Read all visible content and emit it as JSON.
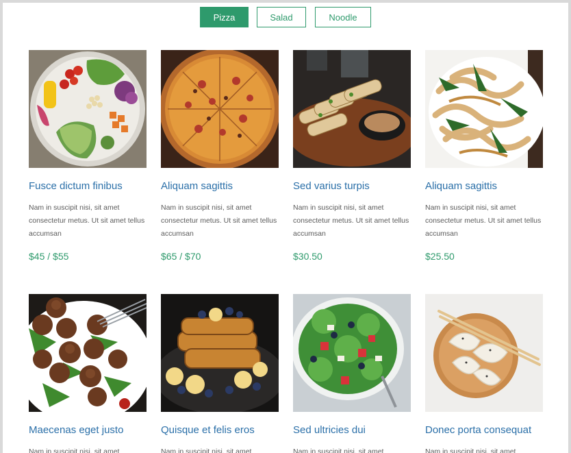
{
  "tabs": [
    {
      "label": "Pizza",
      "active": true
    },
    {
      "label": "Salad",
      "active": false
    },
    {
      "label": "Noodle",
      "active": false
    }
  ],
  "colors": {
    "accent": "#2e9a6c",
    "title": "#2a6fa8",
    "text": "#5b5b5b"
  },
  "products": [
    {
      "title": "Fusce dictum finibus",
      "description": "Nam in suscipit nisi, sit amet consectetur metus. Ut sit amet tellus accumsan",
      "price": "$45 / $55",
      "image": "buddha-bowl-photo"
    },
    {
      "title": "Aliquam sagittis",
      "description": "Nam in suscipit nisi, sit amet consectetur metus. Ut sit amet tellus accumsan",
      "price": "$65 / $70",
      "image": "pizza-photo"
    },
    {
      "title": "Sed varius turpis",
      "description": "Nam in suscipit nisi, sit amet consectetur metus. Ut sit amet tellus accumsan",
      "price": "$30.50",
      "image": "spring-rolls-photo"
    },
    {
      "title": "Aliquam sagittis",
      "description": "Nam in suscipit nisi, sit amet consectetur metus. Ut sit amet tellus accumsan",
      "price": "$25.50",
      "image": "pasta-photo"
    },
    {
      "title": "Maecenas eget justo",
      "description": "Nam in suscipit nisi, sit amet",
      "price": "",
      "image": "meatballs-photo"
    },
    {
      "title": "Quisque et felis eros",
      "description": "Nam in suscipit nisi, sit amet",
      "price": "",
      "image": "french-toast-photo"
    },
    {
      "title": "Sed ultricies dui",
      "description": "Nam in suscipit nisi, sit amet",
      "price": "",
      "image": "greek-salad-photo"
    },
    {
      "title": "Donec porta consequat",
      "description": "Nam in suscipit nisi, sit amet",
      "price": "",
      "image": "dumplings-photo"
    }
  ]
}
